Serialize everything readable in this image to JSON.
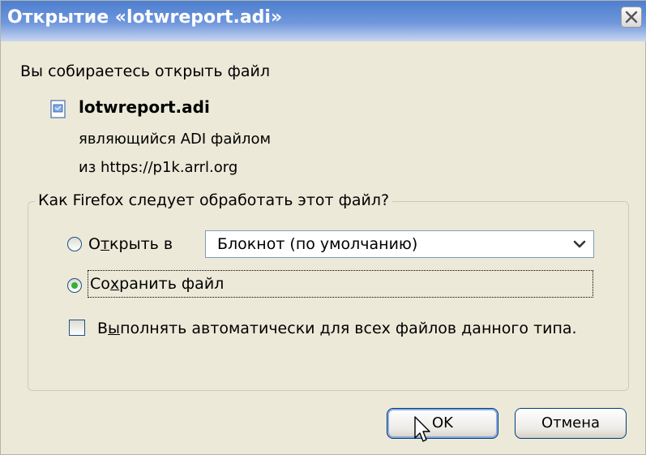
{
  "window": {
    "title": "Открытие «lotwreport.adi»"
  },
  "intro": "Вы собираетесь открыть файл",
  "file": {
    "name": "lotwreport.adi",
    "type_text": "являющийся  ADI файлом",
    "from_text": "из  https://p1k.arrl.org",
    "icon": "document-icon"
  },
  "group": {
    "legend": "Как Firefox следует обработать этот файл?",
    "open_with": {
      "label_before": "О",
      "label_accel": "т",
      "label_after": "крыть в",
      "checked": false,
      "app_value": "Блокнот (по умолчанию)"
    },
    "save_file": {
      "label_before": "Со",
      "label_accel": "х",
      "label_after": "ранить файл",
      "checked": true
    },
    "auto": {
      "label_before": "В",
      "label_accel": "ы",
      "label_after": "полнять автоматически для всех файлов данного типа.",
      "checked": false
    }
  },
  "buttons": {
    "ok": "OK",
    "cancel": "Отмена"
  },
  "colors": {
    "titlebar": "#4d7ecf",
    "dialog_bg": "#ece9d8",
    "radio_checked": "#36b036",
    "button_border": "#003c74"
  }
}
